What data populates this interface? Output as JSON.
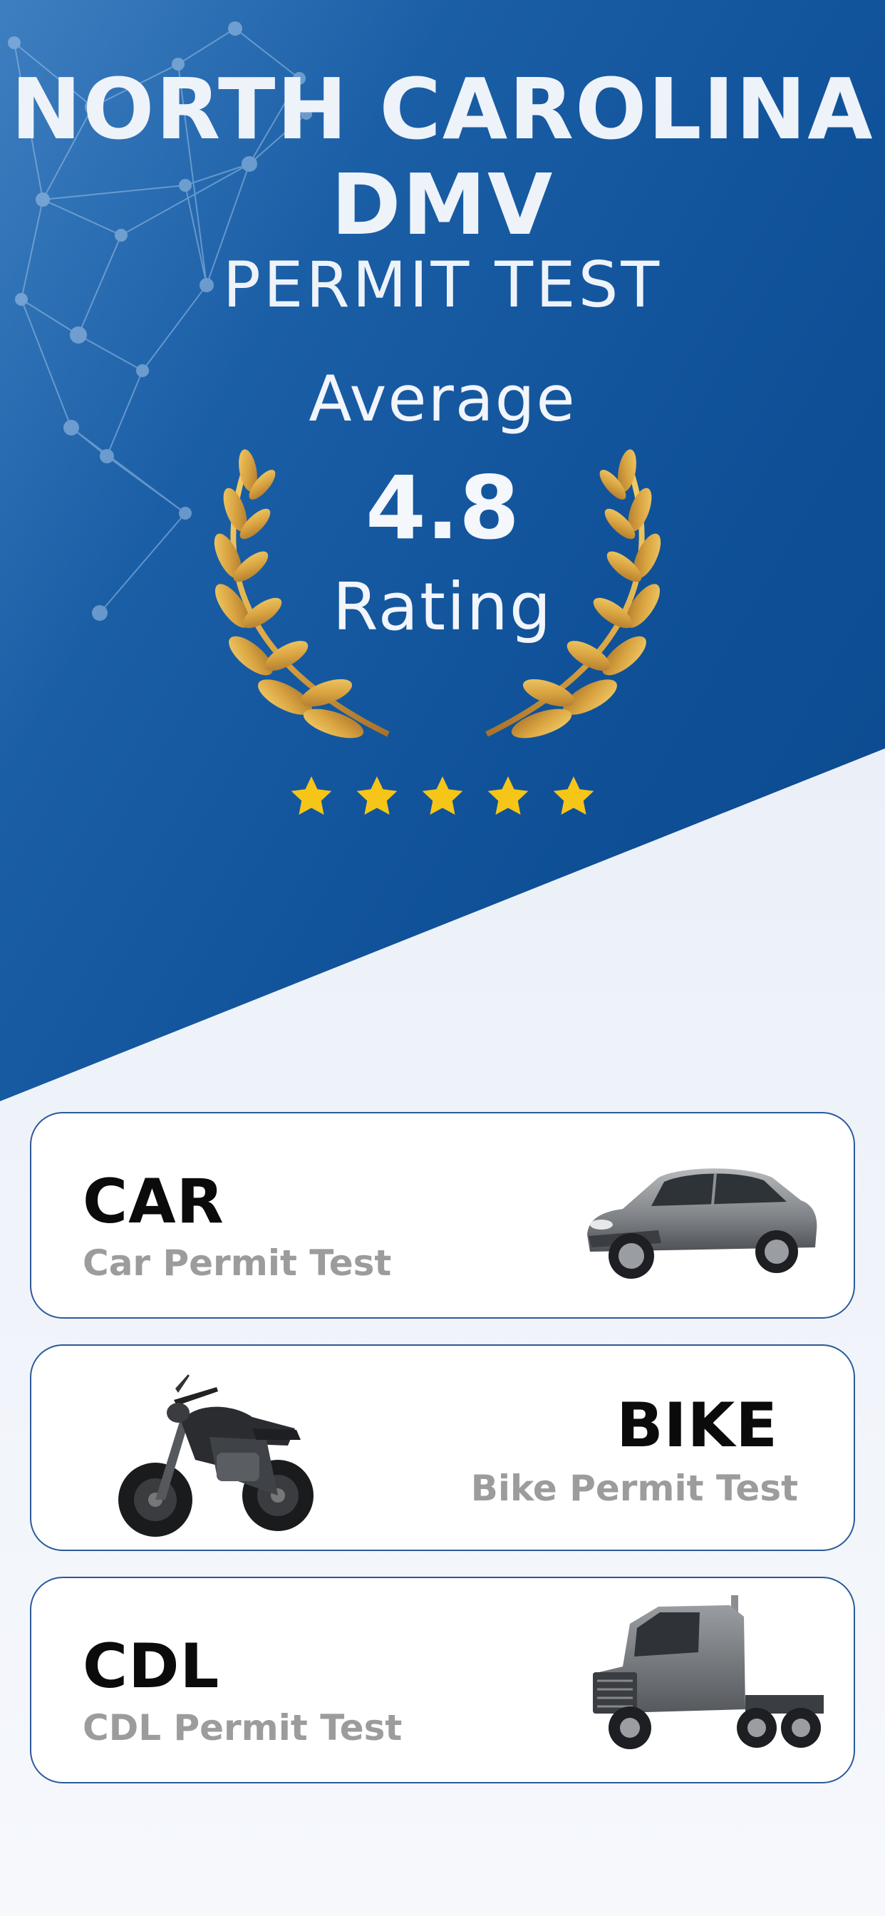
{
  "hero": {
    "title_line1": "NORTH CAROLINA",
    "title_line2": "DMV",
    "subtitle": "PERMIT TEST",
    "rating_prefix": "Average",
    "rating_value": "4.8",
    "rating_suffix": "Rating",
    "stars": 5,
    "star_color": "#f5c518",
    "laurel_color": "#d9a441"
  },
  "colors": {
    "primary_blue": "#0e4f96",
    "card_border": "#2a5a9a",
    "card_subtitle": "#9c9c9c"
  },
  "cards": [
    {
      "title": "CAR",
      "subtitle": "Car Permit Test",
      "icon": "car-icon"
    },
    {
      "title": "BIKE",
      "subtitle": "Bike Permit Test",
      "icon": "motorcycle-icon"
    },
    {
      "title": "CDL",
      "subtitle": "CDL Permit Test",
      "icon": "truck-icon"
    }
  ]
}
